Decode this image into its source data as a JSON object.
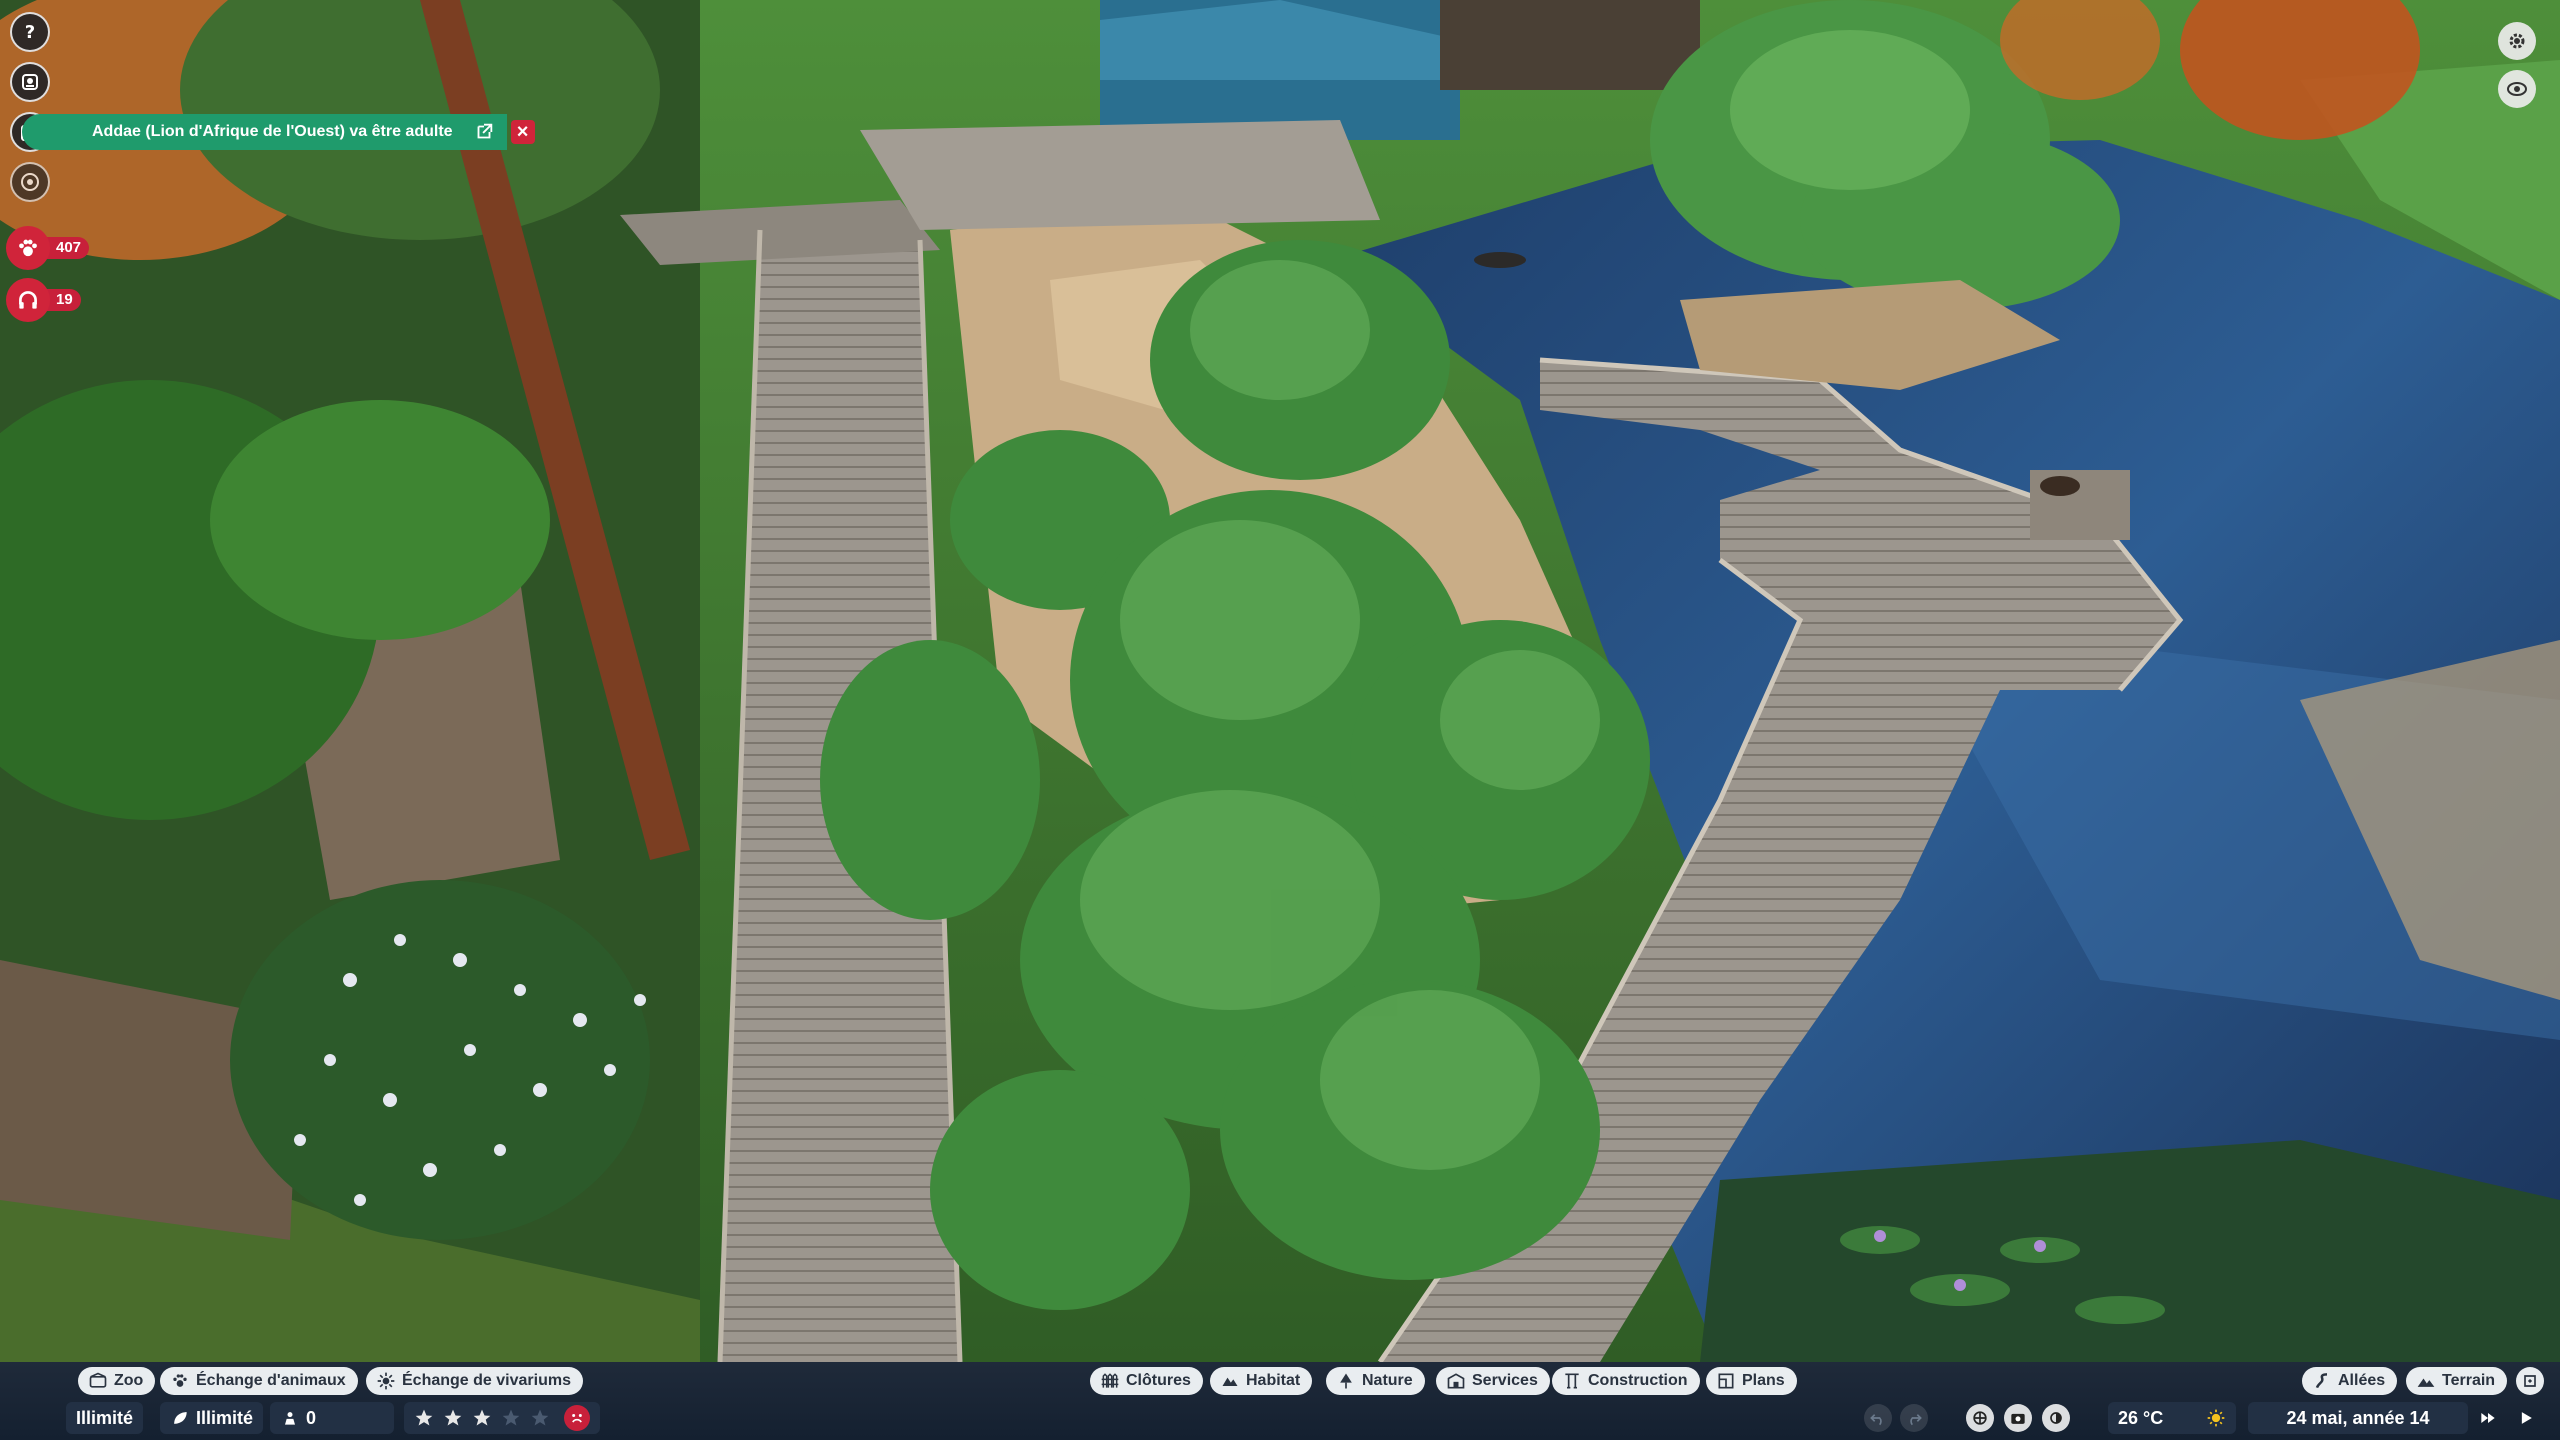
{
  "notification": {
    "text": "Addae (Lion d'Afrique de l'Ouest) va être adulte"
  },
  "left_hud": {
    "animal_count": "407",
    "guest_count": "19"
  },
  "bottom_bar": {
    "left_tabs": [
      {
        "label": "Zoo",
        "icon": "zoo-icon"
      },
      {
        "label": "Échange d'animaux",
        "icon": "paw-icon"
      },
      {
        "label": "Échange de vivariums",
        "icon": "vivarium-icon"
      }
    ],
    "center_tabs": [
      {
        "label": "Clôtures",
        "icon": "fence-icon"
      },
      {
        "label": "Habitat",
        "icon": "habitat-icon"
      },
      {
        "label": "Nature",
        "icon": "tree-icon"
      },
      {
        "label": "Services",
        "icon": "building-icon"
      },
      {
        "label": "Construction",
        "icon": "construction-icon"
      },
      {
        "label": "Plans",
        "icon": "blueprint-icon"
      }
    ],
    "right_tabs": [
      {
        "label": "Allées",
        "icon": "path-icon"
      },
      {
        "label": "Terrain",
        "icon": "terrain-icon"
      }
    ],
    "money": "Illimité",
    "research": "Illimité",
    "conservation": "0",
    "rating_stars": 3,
    "rating_max": 5,
    "temperature": "26 °C",
    "date": "24 mai, année 14",
    "colors": {
      "tab_bg": "#e9edf0",
      "bar_bg": "#1b2636",
      "accent_red": "#c8203a",
      "notification_green": "#1f9b6c",
      "star_fill": "#e8e8e8"
    }
  }
}
